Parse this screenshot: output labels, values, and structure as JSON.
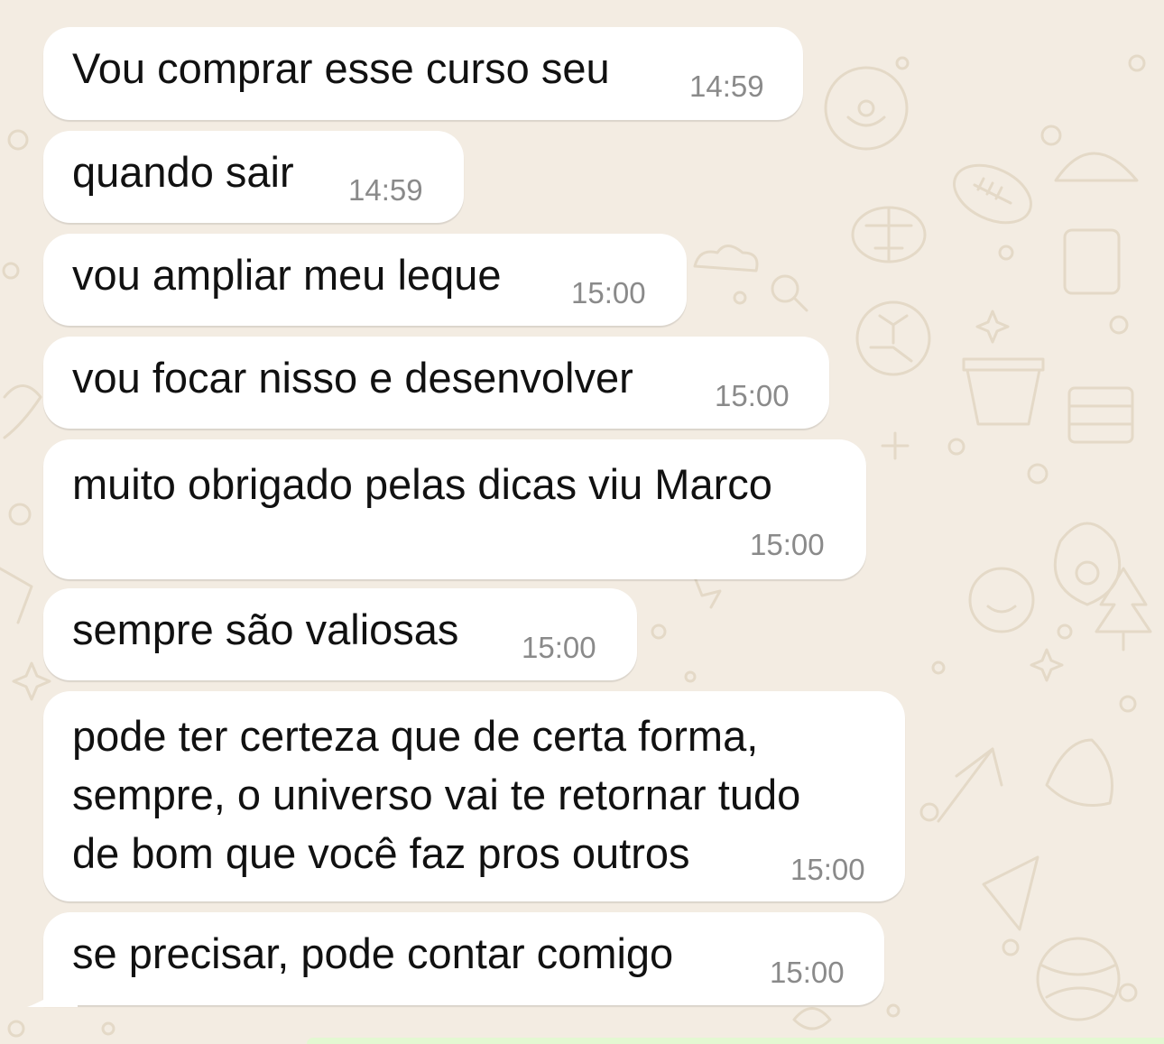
{
  "chat": {
    "messages": [
      {
        "text": "Vou comprar esse curso seu",
        "time": "14:59"
      },
      {
        "text": "quando sair",
        "time": "14:59"
      },
      {
        "text": "vou ampliar meu leque",
        "time": "15:00"
      },
      {
        "text": "vou focar nisso e desenvolver",
        "time": "15:00"
      },
      {
        "text": "muito obrigado pelas dicas viu Marco",
        "time": "15:00"
      },
      {
        "text": "sempre são valiosas",
        "time": "15:00"
      },
      {
        "text": "pode ter certeza que de certa forma,\nsempre, o universo vai te retornar tudo\nde bom que você faz pros outros",
        "time": "15:00"
      },
      {
        "text": "se precisar, pode contar comigo",
        "time": "15:00"
      }
    ]
  },
  "colors": {
    "wallpaper": "#f3ece2",
    "doodles": "#e4d9c7",
    "incoming_bubble": "#ffffff",
    "outgoing_bubble": "#e3f8d2",
    "message_text": "#111111",
    "timestamp": "#8a8a8a"
  }
}
